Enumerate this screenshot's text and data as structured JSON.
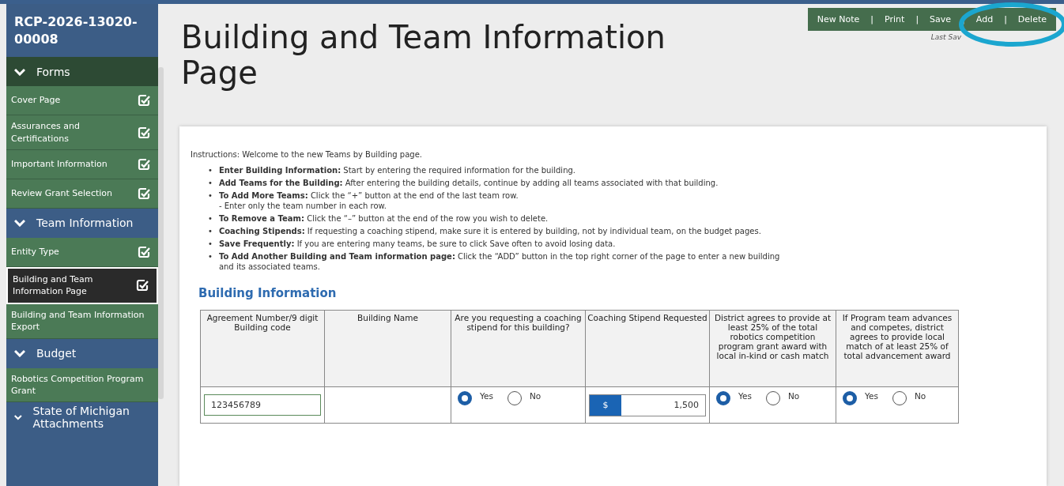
{
  "sidebar": {
    "title": "RCP-2026-13020-00008",
    "sections": [
      {
        "label": "Forms",
        "color": "#2d4a34",
        "items": [
          {
            "label": "Cover Page",
            "checked": true,
            "selected": false
          },
          {
            "label": "Assurances and Certifications",
            "checked": true,
            "selected": false
          },
          {
            "label": "Important Information",
            "checked": true,
            "selected": false
          },
          {
            "label": "Review Grant Selection",
            "checked": true,
            "selected": false
          }
        ]
      },
      {
        "label": "Team Information",
        "color": "#3c5d86",
        "items": [
          {
            "label": "Entity Type",
            "checked": true,
            "selected": false
          },
          {
            "label": "Building and Team Information Page",
            "checked": true,
            "selected": true
          },
          {
            "label": "Building and Team Information Export",
            "checked": false,
            "selected": false
          }
        ]
      },
      {
        "label": "Budget",
        "color": "#3c5d86",
        "items": [
          {
            "label": "Robotics Competition Program Grant",
            "checked": false,
            "selected": false
          }
        ]
      },
      {
        "label": "State of Michigan Attachments",
        "color": "#3c5d86"
      }
    ]
  },
  "page_title": "Building and Team Information Page",
  "toolbar": {
    "buttons": [
      "New Note",
      "Print",
      "Save",
      "Add",
      "Delete"
    ],
    "separator": "|",
    "last_saved": "Last Sav"
  },
  "instructions": {
    "intro": "Instructions: Welcome to the new Teams by Building page.",
    "bullets": [
      {
        "marker": "•",
        "text": "**Enter Building Information:** Start by entering the required information for the building."
      },
      {
        "marker": "•",
        "text": "**Add Teams for the Building:** After entering the building details, continue by adding all teams associated with that building."
      },
      {
        "marker": "•",
        "text": "**To Add More Teams:** Click the “+” button at the end of the last team row.",
        "note": "- Enter only the team number in each row."
      },
      {
        "marker": "•",
        "text": "**To Remove a Team:** Click the “–” button at the end of the row you wish to delete."
      },
      {
        "marker": "•",
        "text": "**Coaching Stipends:** If requesting a coaching stipend, make sure it is entered by building, not by individual team, on the budget pages."
      },
      {
        "marker": "•",
        "text": "**Save Frequently:** If you are entering many teams, be sure to click Save often to avoid losing data."
      },
      {
        "marker": "•",
        "text": "**To Add Another Building and Team information page:** Click the “ADD” button in the top right corner of the page to enter a new building and its associated teams."
      }
    ]
  },
  "building_information": {
    "heading": "Building Information",
    "columns": [
      "Agreement Number/9 digit Building code",
      "Building Name",
      "Are you requesting a coaching stipend for this building?",
      "Coaching Stipend Requested",
      "District agrees to provide at least 25% of the total robotics competition program grant award with local in-kind or cash match",
      "If Program team advances and competes, district agrees to provide local match of at least 25% of total advancement award"
    ],
    "row": [
      {
        "kind": "text",
        "value": "123456789"
      },
      {
        "kind": "empty"
      },
      {
        "kind": "radio",
        "options": [
          {
            "label": "Yes",
            "selected": true
          },
          {
            "label": "No",
            "selected": false
          }
        ]
      },
      {
        "kind": "money",
        "prefix": "$",
        "value": "1,500"
      },
      {
        "kind": "radio",
        "options": [
          {
            "label": "Yes",
            "selected": true
          },
          {
            "label": "No",
            "selected": false
          }
        ]
      },
      {
        "kind": "radio",
        "options": [
          {
            "label": "Yes",
            "selected": true
          },
          {
            "label": "No",
            "selected": false
          }
        ]
      }
    ]
  }
}
